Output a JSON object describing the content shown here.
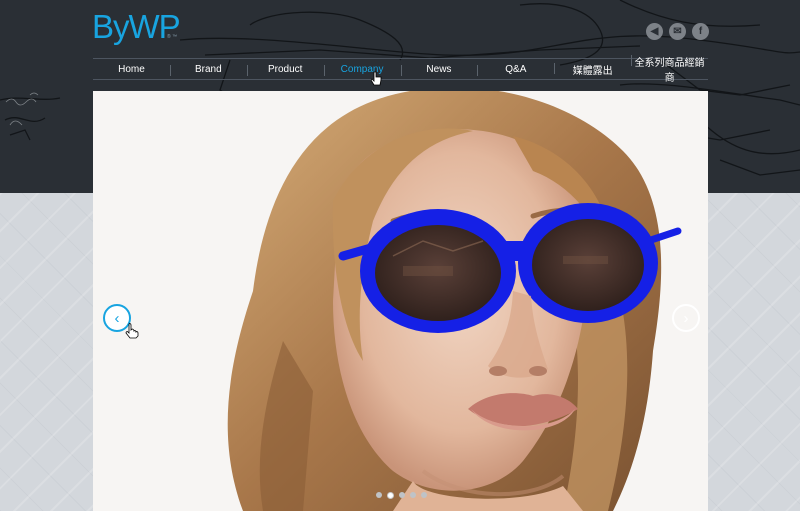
{
  "brand": {
    "logo_text": "ByWP",
    "logo_sub": "® ™",
    "accent": "#18a4e0"
  },
  "social": [
    {
      "name": "speaker-icon",
      "glyph": "◀"
    },
    {
      "name": "mail-icon",
      "glyph": "✉"
    },
    {
      "name": "facebook-icon",
      "glyph": "f"
    }
  ],
  "nav": {
    "items": [
      {
        "label": "Home"
      },
      {
        "label": "Brand"
      },
      {
        "label": "Product"
      },
      {
        "label": "Company",
        "active": true
      },
      {
        "label": "News"
      },
      {
        "label": "Q&A"
      },
      {
        "label": "媒體露出"
      },
      {
        "label": "全系列商品經銷商"
      }
    ]
  },
  "slider": {
    "prev_glyph": "‹",
    "next_glyph": "›",
    "dot_count": 5,
    "active_dot": 1
  },
  "colors": {
    "header_bg": "#2a2f35",
    "glasses": "#1520e6",
    "hair": "#b98a55"
  }
}
